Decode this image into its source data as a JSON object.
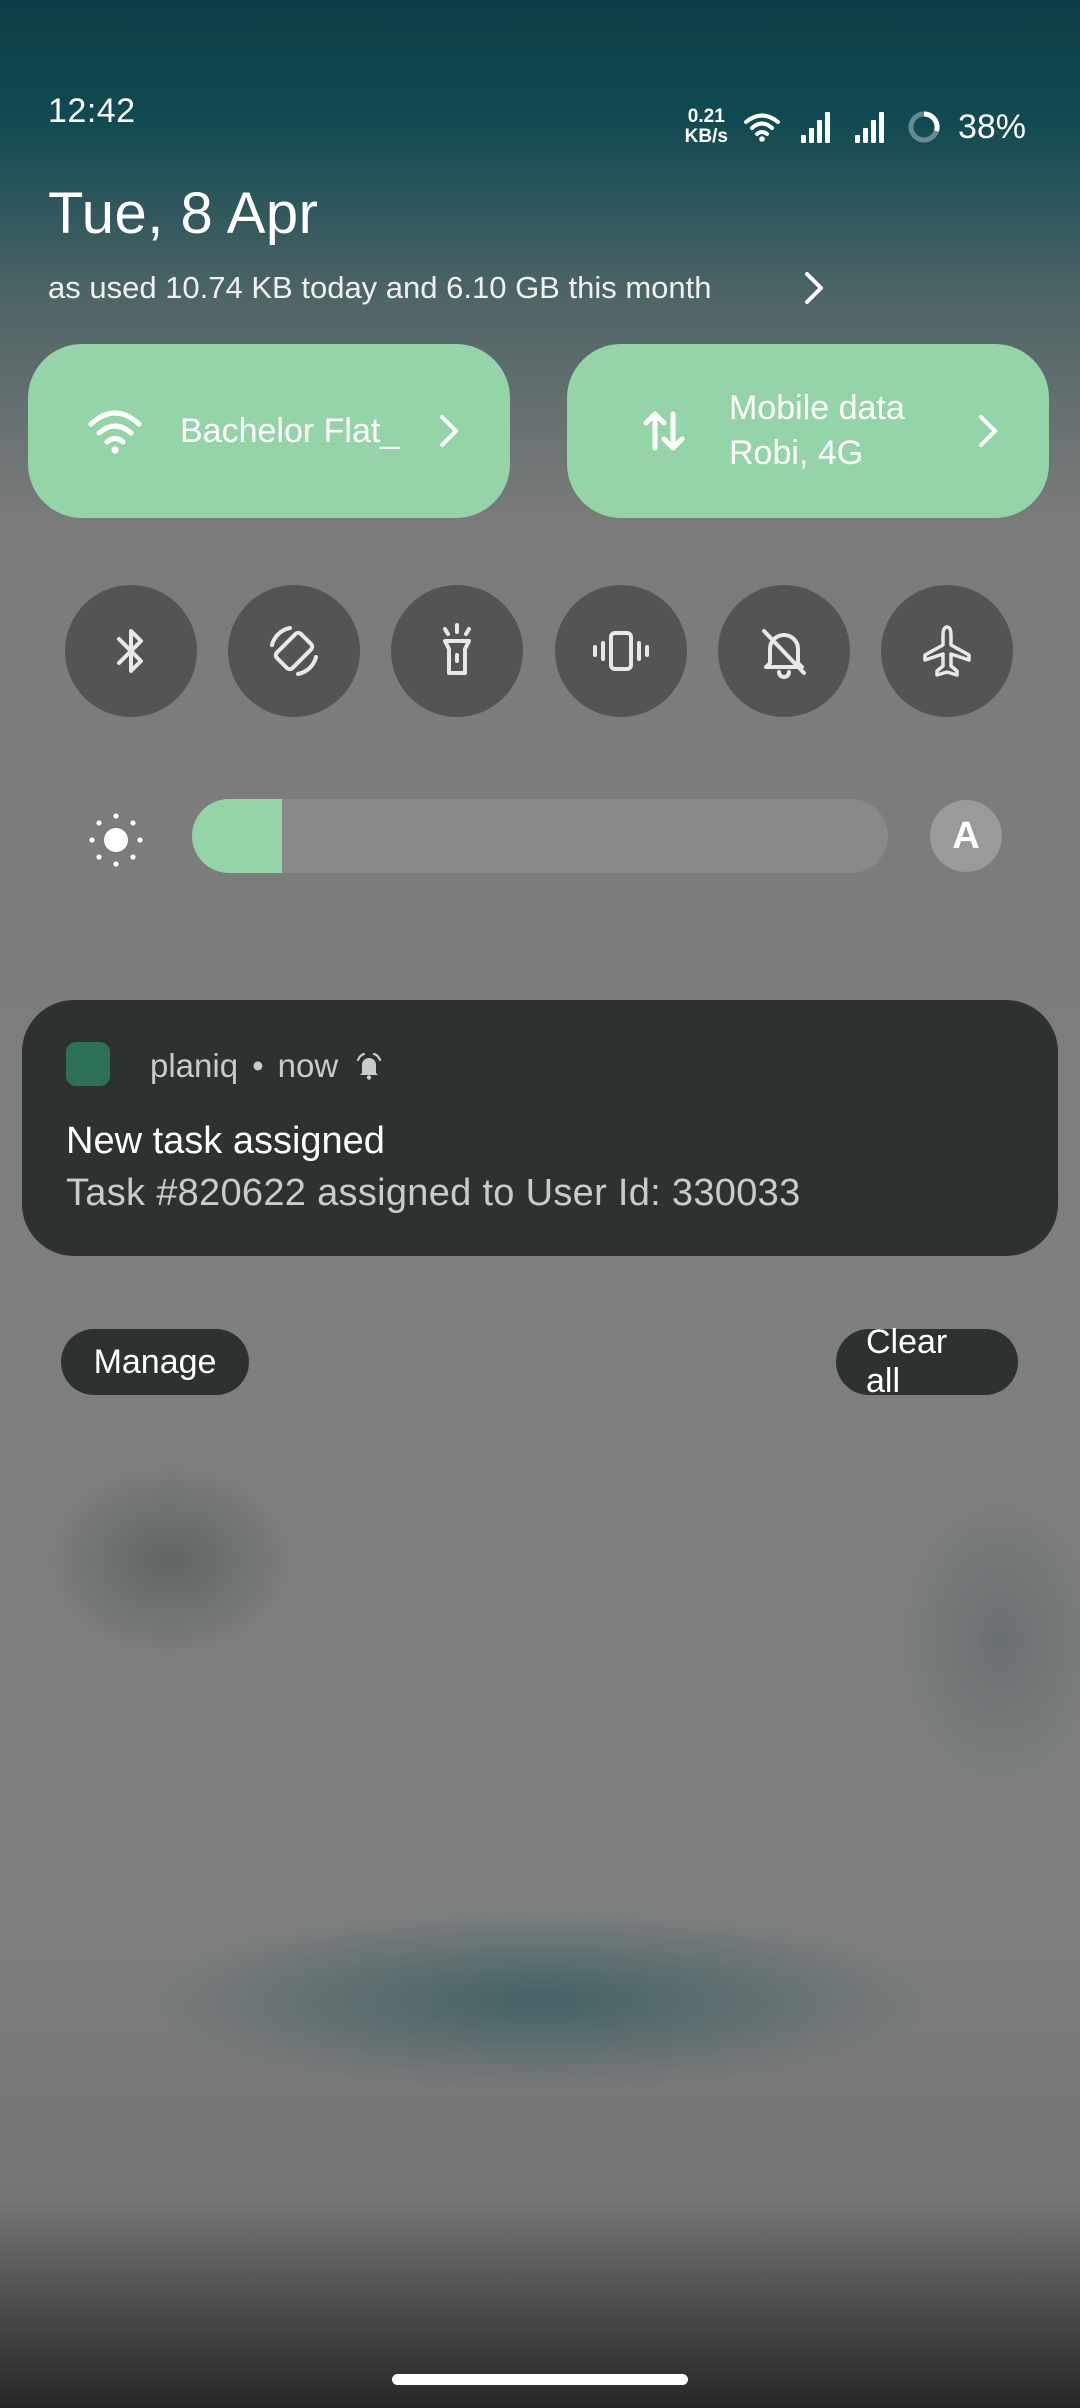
{
  "status_bar": {
    "time": "12:42",
    "net_speed_value": "0.21",
    "net_speed_unit": "KB/s",
    "battery": "38%",
    "icons": [
      "wifi-icon",
      "signal-icon",
      "signal-icon",
      "battery-ring-icon"
    ]
  },
  "header": {
    "date": "Tue, 8 Apr",
    "data_usage": "as used 10.74 KB today and 6.10 GB this month"
  },
  "tiles": {
    "wifi": {
      "icon": "wifi-icon",
      "label": "Bachelor Flat_"
    },
    "mobile_data": {
      "icon": "data-transfer-icon",
      "line1": "Mobile data",
      "line2": "Robi, 4G"
    }
  },
  "toggles": [
    "bluetooth",
    "auto-rotate",
    "flashlight",
    "vibrate",
    "mute",
    "airplane-mode"
  ],
  "brightness": {
    "level_percent": 13,
    "auto_label": "A"
  },
  "notification": {
    "app": "planiq",
    "separator": "•",
    "time": "now",
    "title": "New task assigned",
    "body": "Task #820622 assigned to User Id: 330033"
  },
  "actions": {
    "manage": "Manage",
    "clear_all": "Clear all"
  },
  "colors": {
    "accent": "#95d4a9",
    "card": "#2d3230",
    "toggle": "#545454"
  }
}
